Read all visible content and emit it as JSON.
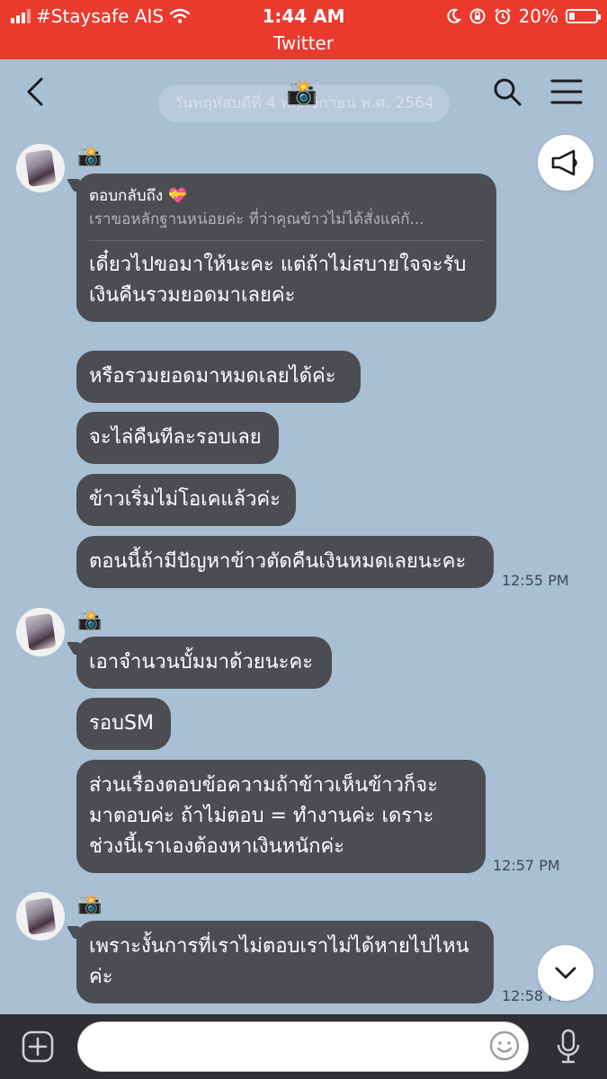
{
  "status_bar": {
    "carrier": "#Staysafe AIS",
    "time": "1:44 AM",
    "battery": "20%",
    "battery_level": 0.2,
    "app_label": "Twitter"
  },
  "header": {
    "chat_icon": "📸",
    "date_banner": "วันพฤหัสบดีที่ 4 พฤศจิกายน พ.ศ. 2564",
    "icons": [
      "back-chevron-icon",
      "search-icon",
      "menu-icon"
    ]
  },
  "messages": [
    {
      "sender": "📸",
      "bubbles": [
        {
          "reply": {
            "label": "ตอบกลับถึง",
            "emoji": "💝",
            "quoted": "เราขอหลักฐานหน่อยค่ะ ที่ว่าคุณข้าวไม่ได้สั่งแค่กั..."
          },
          "lines": [
            "เดี๋ยวไปขอมาให้นะคะ แต่ถ้าไม่สบายใจจะรับ",
            "เงินคืนรวมยอดมาเลยค่ะ"
          ]
        },
        {
          "lines": [
            "หรือรวมยอดมาหมดเลยได้ค่ะ"
          ]
        },
        {
          "lines": [
            "จะไล่คืนทีละรอบเลย"
          ]
        },
        {
          "lines": [
            "ข้าวเริ่มไม่โอเคแล้วค่ะ"
          ]
        },
        {
          "lines": [
            "ตอนนี้ถ้ามีปัญหาข้าวตัดคืนเงินหมดเลยนะคะ"
          ]
        }
      ],
      "time": "12:55 PM"
    },
    {
      "sender": "📸",
      "bubbles": [
        {
          "lines": [
            "เอาจำนวนบั้มมาด้วยนะคะ"
          ]
        },
        {
          "lines": [
            "รอบSM"
          ]
        },
        {
          "lines": [
            "ส่วนเรื่องตอบข้อความถ้าข้าวเห็นข้าวก็จะ",
            "มาตอบค่ะ ถ้าไม่ตอบ = ทำงานค่ะ เดราะ",
            "ช่วงนี้เราเองต้องหาเงินหนักค่ะ"
          ]
        }
      ],
      "time": "12:57 PM"
    },
    {
      "sender": "📸",
      "bubbles": [
        {
          "lines": [
            "เพราะงั้นการที่เราไม่ตอบเราไม่ได้หายไปไหน",
            "ค่ะ"
          ]
        }
      ],
      "time": "12:58 PM"
    }
  ],
  "floating": {
    "announce_icon": "megaphone-icon",
    "scroll_icon": "chevron-down-icon"
  },
  "composer": {
    "placeholder": "",
    "icons": [
      "plus-icon",
      "emoji-icon",
      "microphone-icon"
    ]
  }
}
